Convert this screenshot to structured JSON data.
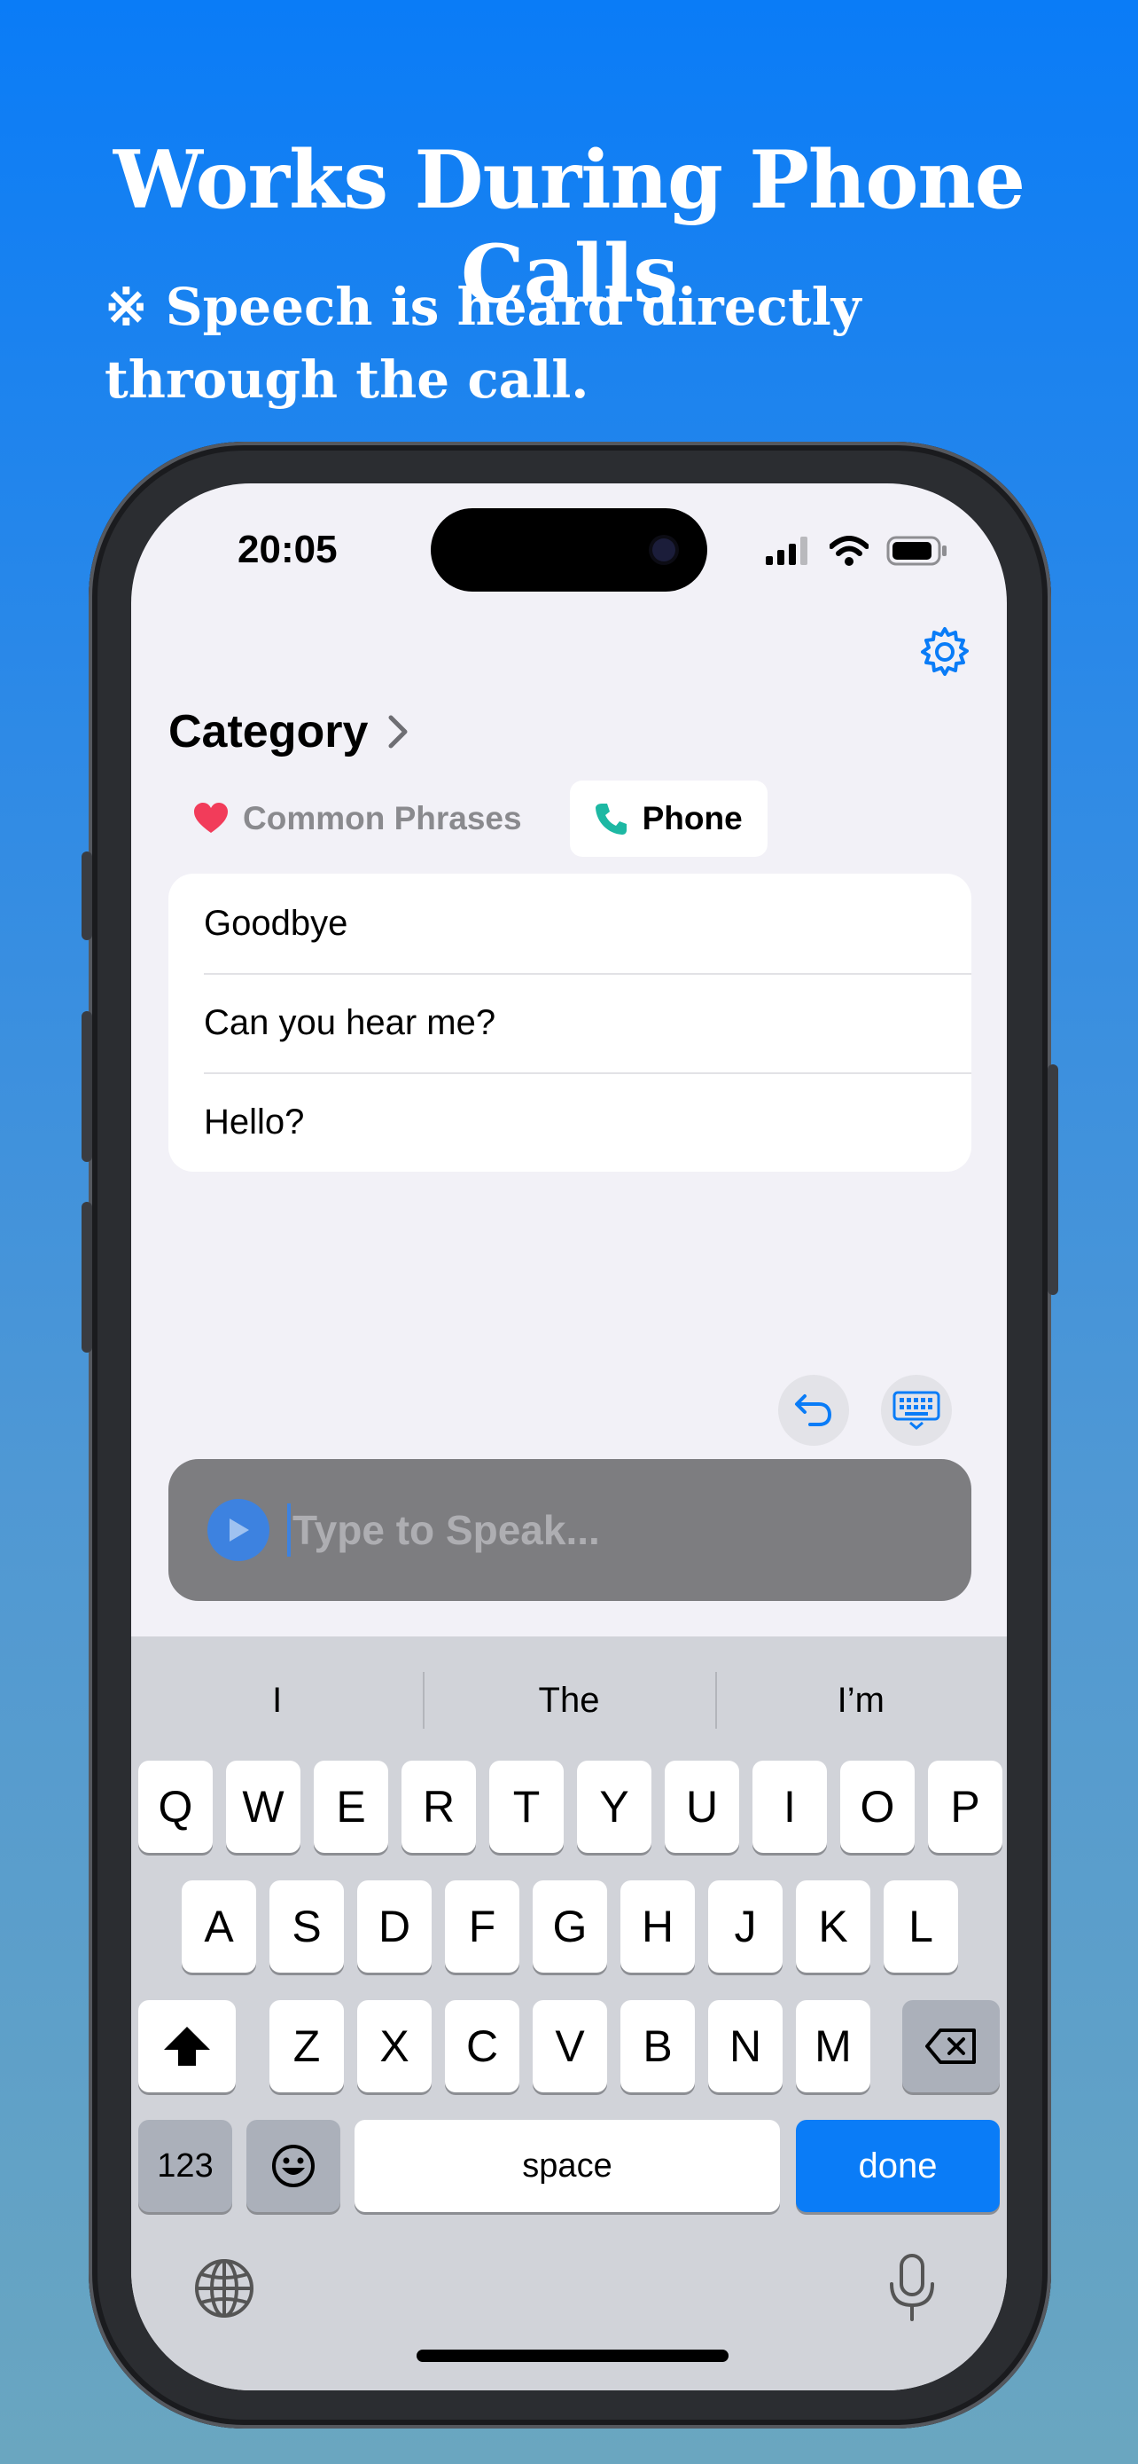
{
  "promo": {
    "headline": "Works During Phone Calls",
    "subline": "※ Speech is heard directly through the call."
  },
  "status_bar": {
    "time": "20:05"
  },
  "header": {
    "category_label": "Category"
  },
  "tabs": [
    {
      "label": "Common Phrases",
      "icon": "heart-icon",
      "active": false
    },
    {
      "label": "Phone",
      "icon": "phone-icon",
      "active": true
    }
  ],
  "phrases": [
    "Goodbye",
    "Can you hear me?",
    "Hello?"
  ],
  "input": {
    "placeholder": "Type to Speak..."
  },
  "keyboard": {
    "suggestions": [
      "I",
      "The",
      "I’m"
    ],
    "row1": [
      "Q",
      "W",
      "E",
      "R",
      "T",
      "Y",
      "U",
      "I",
      "O",
      "P"
    ],
    "row2": [
      "A",
      "S",
      "D",
      "F",
      "G",
      "H",
      "J",
      "K",
      "L"
    ],
    "row3": [
      "Z",
      "X",
      "C",
      "V",
      "B",
      "N",
      "M"
    ],
    "numbers_label": "123",
    "space_label": "space",
    "done_label": "done"
  },
  "colors": {
    "accent": "#0a7cf7",
    "heart": "#f23c5a",
    "phone": "#1db8a3"
  }
}
